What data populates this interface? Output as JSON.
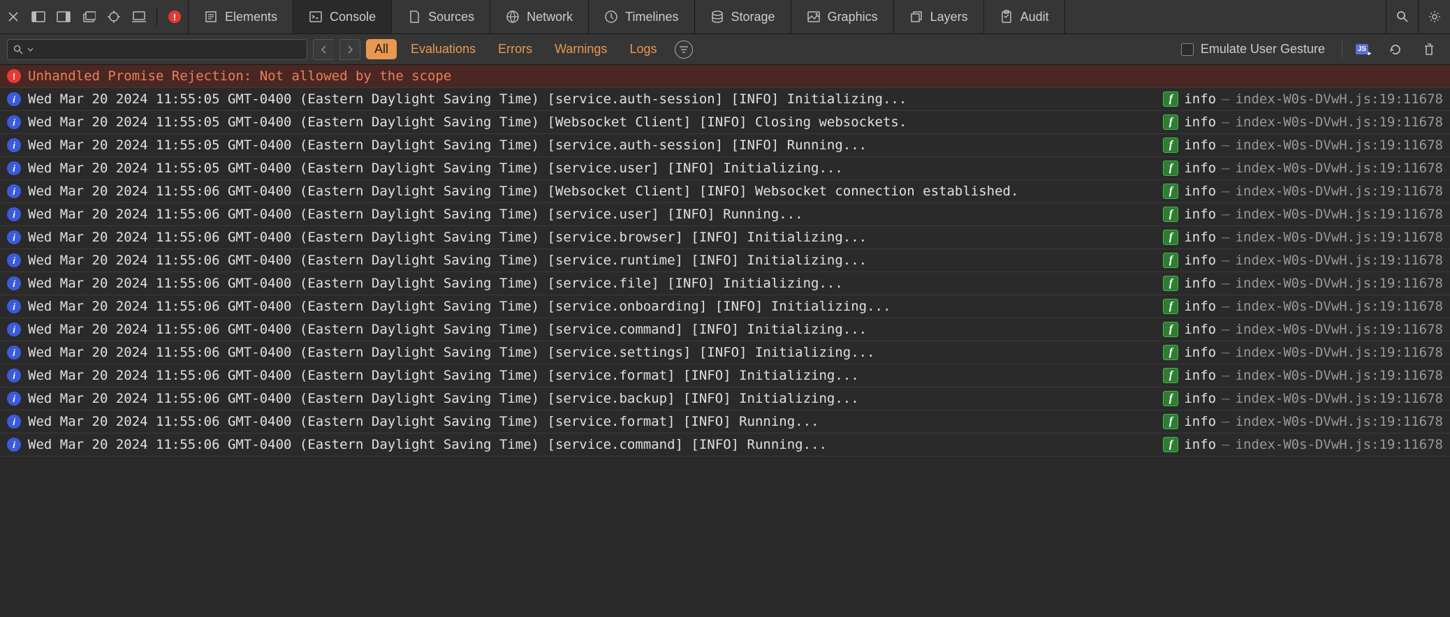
{
  "tabs": [
    {
      "label": "Elements",
      "icon": "elements"
    },
    {
      "label": "Console",
      "icon": "console",
      "active": true
    },
    {
      "label": "Sources",
      "icon": "sources"
    },
    {
      "label": "Network",
      "icon": "network"
    },
    {
      "label": "Timelines",
      "icon": "timelines"
    },
    {
      "label": "Storage",
      "icon": "storage"
    },
    {
      "label": "Graphics",
      "icon": "graphics"
    },
    {
      "label": "Layers",
      "icon": "layers"
    },
    {
      "label": "Audit",
      "icon": "audit"
    }
  ],
  "filters": {
    "all": "All",
    "evaluations": "Evaluations",
    "errors": "Errors",
    "warnings": "Warnings",
    "logs": "Logs"
  },
  "emulate_label": "Emulate User Gesture",
  "error_row": {
    "message": "Unhandled Promise Rejection: Not allowed by the scope"
  },
  "log_level": "info",
  "log_dash": "—",
  "log_source": "index-W0s-DVwH.js:19:11678",
  "logs": [
    {
      "message": "Wed Mar 20 2024 11:55:05 GMT-0400 (Eastern Daylight Saving Time) [service.auth-session] [INFO] Initializing..."
    },
    {
      "message": "Wed Mar 20 2024 11:55:05 GMT-0400 (Eastern Daylight Saving Time) [Websocket Client] [INFO] Closing websockets."
    },
    {
      "message": "Wed Mar 20 2024 11:55:05 GMT-0400 (Eastern Daylight Saving Time) [service.auth-session] [INFO] Running..."
    },
    {
      "message": "Wed Mar 20 2024 11:55:05 GMT-0400 (Eastern Daylight Saving Time) [service.user] [INFO] Initializing..."
    },
    {
      "message": "Wed Mar 20 2024 11:55:06 GMT-0400 (Eastern Daylight Saving Time) [Websocket Client] [INFO] Websocket connection established."
    },
    {
      "message": "Wed Mar 20 2024 11:55:06 GMT-0400 (Eastern Daylight Saving Time) [service.user] [INFO] Running..."
    },
    {
      "message": "Wed Mar 20 2024 11:55:06 GMT-0400 (Eastern Daylight Saving Time) [service.browser] [INFO] Initializing..."
    },
    {
      "message": "Wed Mar 20 2024 11:55:06 GMT-0400 (Eastern Daylight Saving Time) [service.runtime] [INFO] Initializing..."
    },
    {
      "message": "Wed Mar 20 2024 11:55:06 GMT-0400 (Eastern Daylight Saving Time) [service.file] [INFO] Initializing..."
    },
    {
      "message": "Wed Mar 20 2024 11:55:06 GMT-0400 (Eastern Daylight Saving Time) [service.onboarding] [INFO] Initializing..."
    },
    {
      "message": "Wed Mar 20 2024 11:55:06 GMT-0400 (Eastern Daylight Saving Time) [service.command] [INFO] Initializing..."
    },
    {
      "message": "Wed Mar 20 2024 11:55:06 GMT-0400 (Eastern Daylight Saving Time) [service.settings] [INFO] Initializing..."
    },
    {
      "message": "Wed Mar 20 2024 11:55:06 GMT-0400 (Eastern Daylight Saving Time) [service.format] [INFO] Initializing..."
    },
    {
      "message": "Wed Mar 20 2024 11:55:06 GMT-0400 (Eastern Daylight Saving Time) [service.backup] [INFO] Initializing..."
    },
    {
      "message": "Wed Mar 20 2024 11:55:06 GMT-0400 (Eastern Daylight Saving Time) [service.format] [INFO] Running..."
    },
    {
      "message": "Wed Mar 20 2024 11:55:06 GMT-0400 (Eastern Daylight Saving Time) [service.command] [INFO] Running..."
    }
  ]
}
